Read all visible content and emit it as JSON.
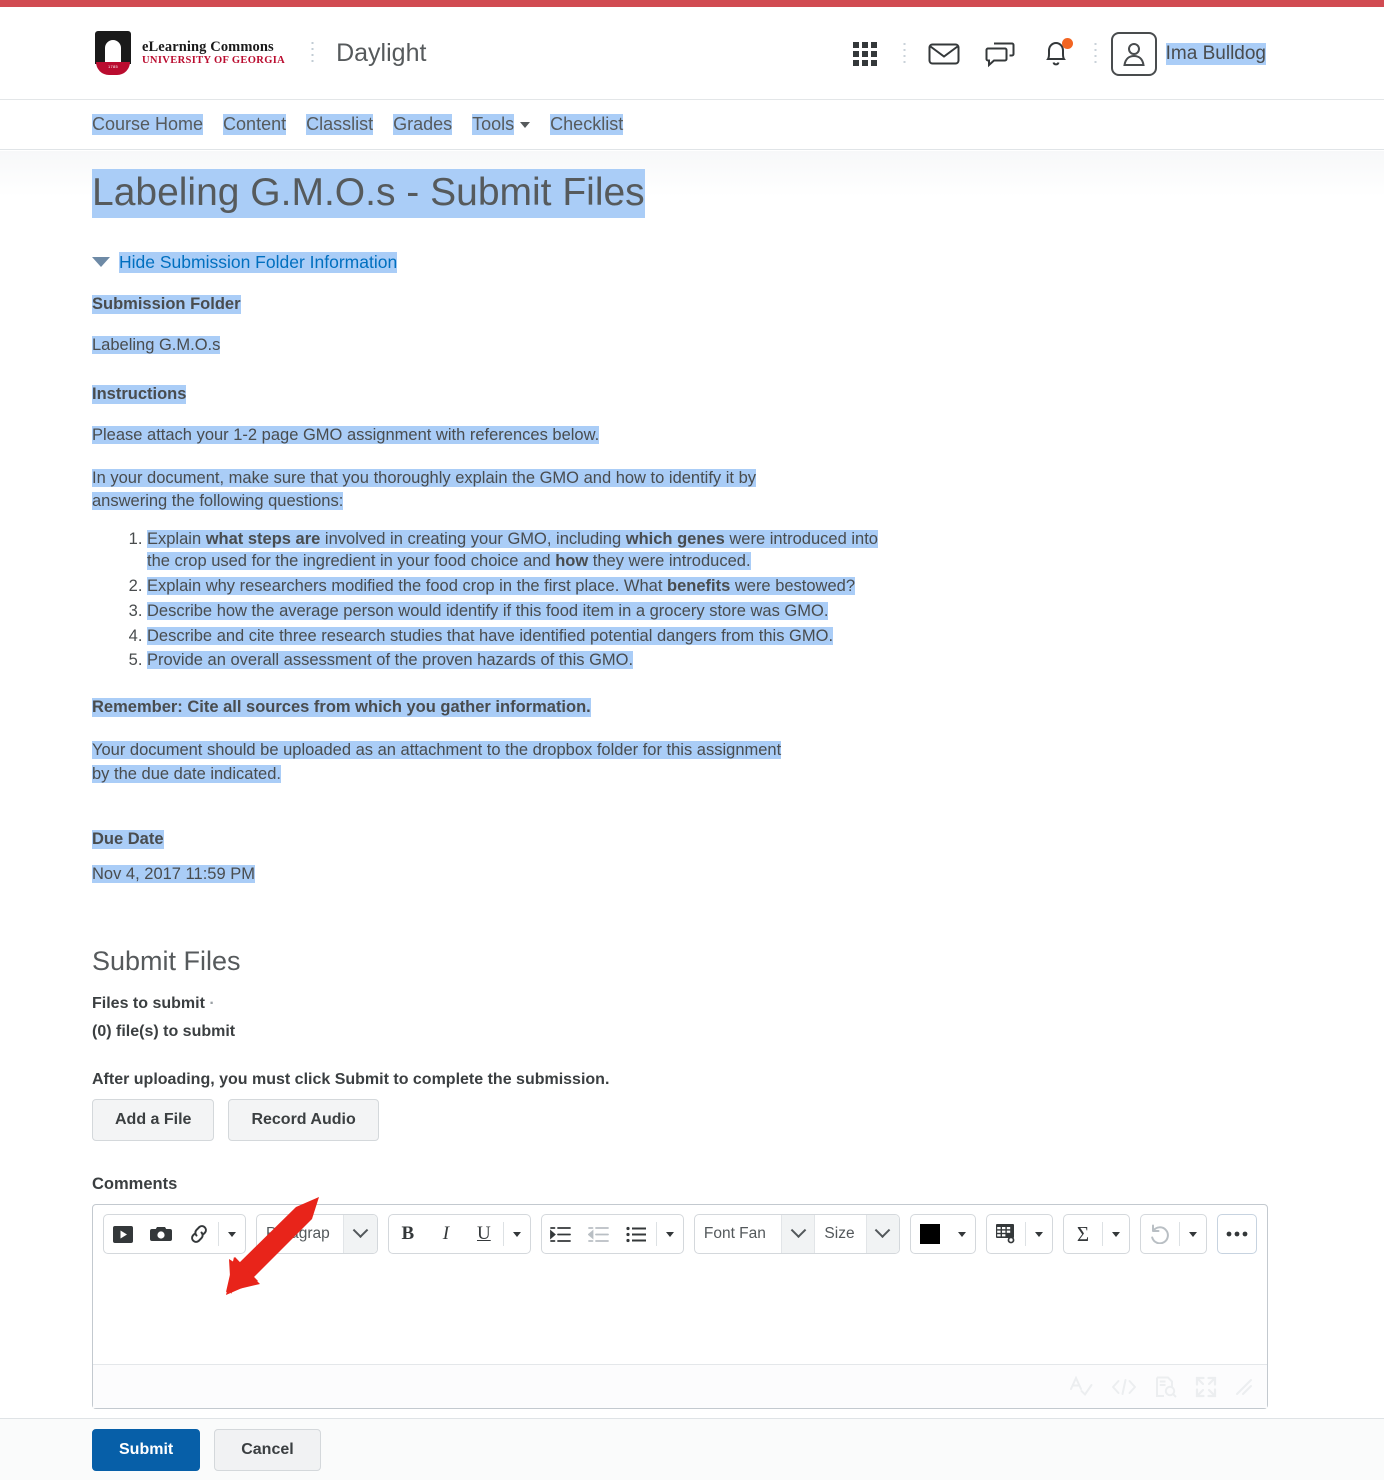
{
  "brand": {
    "logo_line1": "eLearning Commons",
    "logo_line2": "UNIVERSITY OF GEORGIA",
    "logo_year": "1785",
    "course_name": "Daylight"
  },
  "header": {
    "icons": [
      "waffle-grid-icon",
      "envelope-icon",
      "chat-bubble-icon",
      "bell-icon"
    ],
    "notification_dot_color": "#f26522",
    "user_name": "Ima Bulldog"
  },
  "nav": {
    "items": [
      {
        "label": "Course Home",
        "has_caret": false
      },
      {
        "label": "Content",
        "has_caret": false
      },
      {
        "label": "Classlist",
        "has_caret": false
      },
      {
        "label": "Grades",
        "has_caret": false
      },
      {
        "label": "Tools",
        "has_caret": true
      },
      {
        "label": "Checklist",
        "has_caret": false
      }
    ]
  },
  "page": {
    "title": "Labeling G.M.O.s - Submit Files",
    "toggle_link": "Hide Submission Folder Information",
    "submission_folder_label": "Submission Folder",
    "submission_folder_value": "Labeling G.M.O.s",
    "instructions_label": "Instructions",
    "intro_1": "Please attach your 1-2 page GMO assignment with references below.",
    "intro_2": "In your document, make sure that you thoroughly explain the GMO and how to identify it by answering the following questions:",
    "questions": [
      {
        "parts": [
          {
            "text": "Explain ",
            "bold": false
          },
          {
            "text": "what steps are",
            "bold": true
          },
          {
            "text": " involved in creating your GMO, including ",
            "bold": false
          },
          {
            "text": "which genes",
            "bold": true
          },
          {
            "text": " were introduced into the crop used for the ingredient in your food choice and ",
            "bold": false
          },
          {
            "text": "how",
            "bold": true
          },
          {
            "text": " they were introduced.",
            "bold": false
          }
        ]
      },
      {
        "parts": [
          {
            "text": "Explain why researchers modified the food crop in the first place. What ",
            "bold": false
          },
          {
            "text": "benefits",
            "bold": true
          },
          {
            "text": " were bestowed?",
            "bold": false
          }
        ]
      },
      {
        "parts": [
          {
            "text": "Describe how the average person would identify if this food item in a grocery store was GMO.",
            "bold": false
          }
        ]
      },
      {
        "parts": [
          {
            "text": "Describe and cite three research studies that have identified potential dangers from this GMO.",
            "bold": false
          }
        ]
      },
      {
        "parts": [
          {
            "text": "Provide an overall assessment of the proven hazards of this GMO.",
            "bold": false
          }
        ]
      }
    ],
    "remember_note": "Remember: Cite all sources from which you gather information.",
    "closing_note": "Your document should be uploaded as an attachment to the dropbox folder for this assignment by the due date indicated.",
    "due_date_label": "Due Date",
    "due_date_value": "Nov 4, 2017 11:59 PM"
  },
  "submit_section": {
    "heading": "Submit Files",
    "files_to_submit_label": "Files to submit",
    "files_count_text": "(0) file(s) to submit",
    "after_upload_note": "After uploading, you must click Submit to complete the submission.",
    "add_file_button": "Add a File",
    "record_audio_button": "Record Audio"
  },
  "comments": {
    "label": "Comments",
    "toolbar": {
      "group1": [
        "insert-stuff-icon",
        "camera-icon",
        "link-icon"
      ],
      "paragraph_select": "Paragrap",
      "format_buttons": [
        "bold-icon",
        "italic-icon",
        "underline-icon"
      ],
      "list_buttons": [
        "indent-icon",
        "outdent-icon",
        "bullet-list-icon"
      ],
      "font_family_select": "Font Fan",
      "font_size_select": "Size",
      "color_swatch": "#000000",
      "table_icon": "table-icon",
      "equation_icon": "equation-sigma-icon",
      "undo_icon": "undo-icon",
      "more_icon": "more-options-icon"
    },
    "footer_icons": [
      "spellcheck-icon",
      "html-source-icon",
      "preview-icon",
      "fullscreen-icon",
      "resize-grip-icon"
    ],
    "editor_value": ""
  },
  "footer": {
    "submit_button": "Submit",
    "cancel_button": "Cancel",
    "submit_color": "#075fa8"
  },
  "annotation": {
    "type": "red-arrow",
    "color": "#e8241a",
    "points_to": "Add a File"
  },
  "colors": {
    "top_bar": "#d14b52",
    "selection_highlight": "#aacdf7",
    "link": "#006fbf",
    "text": "#494c4e"
  }
}
